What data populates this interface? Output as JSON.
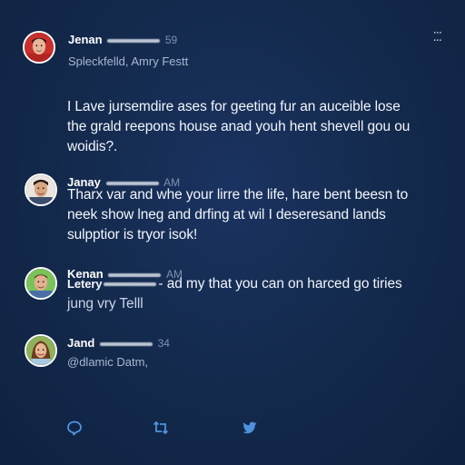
{
  "post": {
    "author": "Jenan",
    "time": "59",
    "location": "Spleckfelld, Amry Festt",
    "menu_icon": "more-options-icon",
    "text_lines": [
      "I Lave jursemdire ases for geeting fur an auceible lose",
      "the grald reepons house anad youh hent shevell gou ou",
      "woidis?."
    ]
  },
  "replies": [
    {
      "name": "Janay",
      "time": "AM",
      "text_lines": [
        "Tharx var and whe your lirre the life, hare bent beesn to",
        "neek show lneg and drfing at wil I deseresand lands",
        "sulpptior is tryor isok!"
      ]
    },
    {
      "name": "Kenan",
      "time": "AM",
      "name2": "Letery",
      "text_after": "- ad my that you can on harced go tiries",
      "text_line2": "jung vry Telll"
    },
    {
      "name": "Jand",
      "time": "34",
      "text_line1": "@dlamic Datm,"
    }
  ],
  "actions": {
    "reply_icon": "reply-icon",
    "retweet_icon": "retweet-icon",
    "share_icon": "bird-icon"
  },
  "colors": {
    "background": "#13294b",
    "accent": "#4d93e0",
    "muted": "#7f8fb0"
  }
}
